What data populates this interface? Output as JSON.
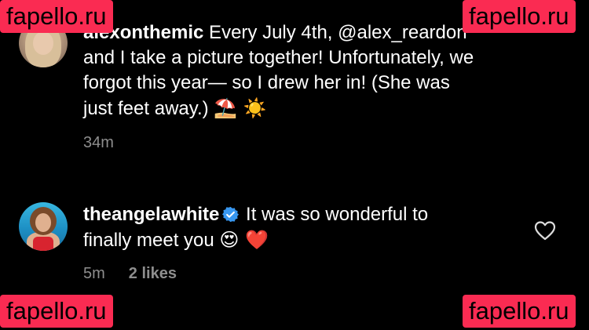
{
  "comments": [
    {
      "username": "alexonthemic",
      "text_line1": " Every July 4th, @alex_reardon",
      "text_line2": "and I take a picture together! Unfortunately, we",
      "text_line3": "forgot this year— so I drew her in! (She was",
      "text_line4": "just feet away.) ",
      "emojis": "⛱️ ☀️",
      "time": "34m"
    },
    {
      "username": "theangelawhite",
      "verified": true,
      "text_line1": " It was so wonderful to",
      "text_line2": "finally meet you ",
      "emojis": "😍 ❤️",
      "time": "5m",
      "likes": "2 likes",
      "like_icon": "heart-outline-icon"
    }
  ],
  "watermarks": [
    "fapello.ru",
    "fapello.ru",
    "fapello.ru",
    "fapello.ru"
  ],
  "colors": {
    "background": "#000000",
    "text": "#ffffff",
    "meta": "#8e8e8e",
    "verified": "#3897f0",
    "watermark_bg": "#fa2b52"
  }
}
